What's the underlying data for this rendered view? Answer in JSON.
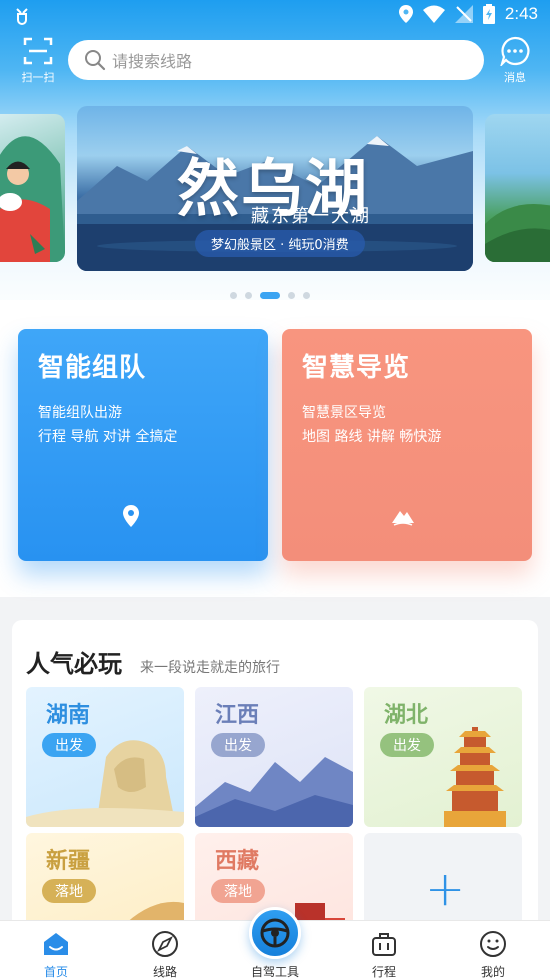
{
  "status_bar": {
    "time": "2:43"
  },
  "header": {
    "scan_label": "扫一扫",
    "search_placeholder": "请搜索线路",
    "message_label": "消息"
  },
  "banner": {
    "title": "然乌湖",
    "subtitle": "藏东第一大湖",
    "pill": "梦幻般景区 · 纯玩0消费",
    "page_count": 5,
    "active_page": 3
  },
  "features": [
    {
      "title": "智能组队",
      "line1": "智能组队出游",
      "line2": "行程 导航 对讲 全搞定",
      "icon": "location-pin-icon"
    },
    {
      "title": "智慧导览",
      "line1": "智慧景区导览",
      "line2": "地图 路线 讲解 畅快游",
      "icon": "mountain-icon"
    }
  ],
  "popular": {
    "title": "人气必玩",
    "subtitle": "来一段说走就走的旅行",
    "cards": [
      {
        "name": "湖南",
        "tag": "出发"
      },
      {
        "name": "江西",
        "tag": "出发"
      },
      {
        "name": "湖北",
        "tag": "出发"
      },
      {
        "name": "新疆",
        "tag": "落地"
      },
      {
        "name": "西藏",
        "tag": "落地"
      },
      {
        "name": "+",
        "tag": ""
      }
    ]
  },
  "tabbar": {
    "home": "首页",
    "route": "线路",
    "drive_tools": "自驾工具",
    "trip": "行程",
    "mine": "我的",
    "active": "home"
  },
  "colors": {
    "primary": "#2a8de8",
    "team_card": "#2892f1",
    "guide_card": "#f38e7a"
  }
}
